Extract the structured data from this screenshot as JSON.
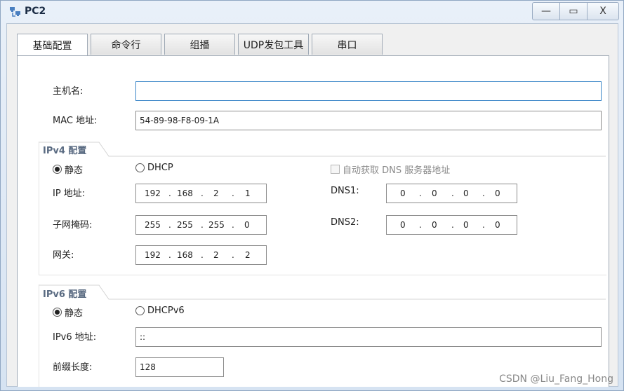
{
  "window": {
    "title": "PC2",
    "minimize": "—",
    "maximize": "▭",
    "close": "X"
  },
  "tabs": [
    "基础配置",
    "命令行",
    "组播",
    "UDP发包工具",
    "串口"
  ],
  "basic": {
    "hostname_label": "主机名:",
    "hostname_value": "",
    "mac_label": "MAC 地址:",
    "mac_value": "54-89-98-F8-09-1A"
  },
  "ipv4": {
    "section_title": "IPv4 配置",
    "static_label": "静态",
    "dhcp_label": "DHCP",
    "auto_dns_label": "自动获取 DNS 服务器地址",
    "ip_label": "IP 地址:",
    "ip": [
      "192",
      "168",
      "2",
      "1"
    ],
    "mask_label": "子网掩码:",
    "mask": [
      "255",
      "255",
      "255",
      "0"
    ],
    "gateway_label": "网关:",
    "gateway": [
      "192",
      "168",
      "2",
      "2"
    ],
    "dns1_label": "DNS1:",
    "dns1": [
      "0",
      "0",
      "0",
      "0"
    ],
    "dns2_label": "DNS2:",
    "dns2": [
      "0",
      "0",
      "0",
      "0"
    ]
  },
  "ipv6": {
    "section_title": "IPv6 配置",
    "static_label": "静态",
    "dhcp_label": "DHCPv6",
    "ip_label": "IPv6 地址:",
    "ip_value": "::",
    "prefix_label": "前缀长度:",
    "prefix_value": "128"
  },
  "watermark": "CSDN @Liu_Fang_Hong"
}
